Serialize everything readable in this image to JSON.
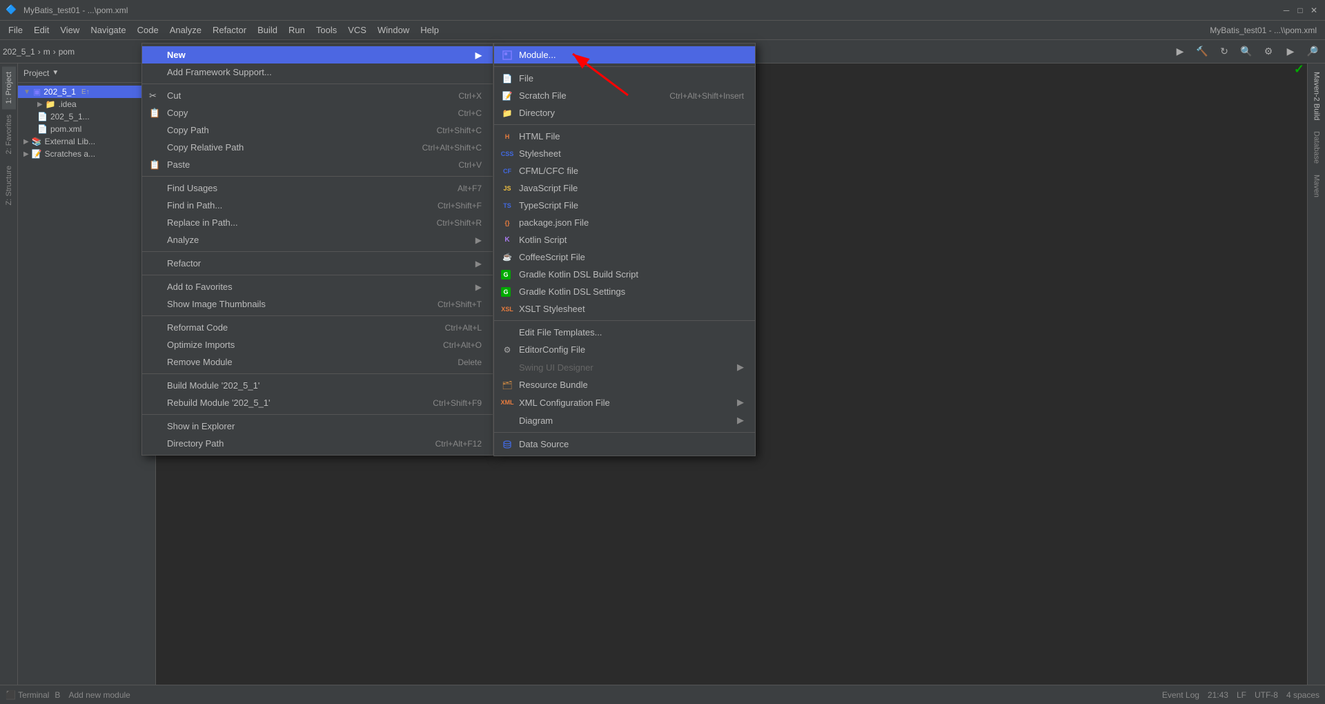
{
  "app": {
    "title": "MyBatis_test01 - ...\\pom.xml",
    "logo": "🔷"
  },
  "titleBar": {
    "title": "MyBatis_test01 - ...\\pom.xml",
    "minimizeLabel": "─",
    "maximizeLabel": "□",
    "closeLabel": "✕"
  },
  "menuBar": {
    "items": [
      "File",
      "Edit",
      "View",
      "Navigate",
      "Code",
      "Analyze",
      "Refactor",
      "Build",
      "Run",
      "Tools",
      "VCS",
      "Window",
      "Help"
    ]
  },
  "toolbar": {
    "breadcrumb": [
      "202_5_1",
      "m",
      "pom"
    ]
  },
  "projectPanel": {
    "title": "Project",
    "items": [
      {
        "label": "202_5_1",
        "indent": 0,
        "type": "module",
        "selected": true
      },
      {
        "label": ".idea",
        "indent": 1,
        "type": "folder"
      },
      {
        "label": "202_5_1...",
        "indent": 1,
        "type": "file"
      },
      {
        "label": "pom.xml",
        "indent": 1,
        "type": "file"
      },
      {
        "label": "External Lib...",
        "indent": 0,
        "type": "lib"
      },
      {
        "label": "Scratches a...",
        "indent": 0,
        "type": "scratch"
      }
    ]
  },
  "contextMenu": {
    "items": [
      {
        "id": "new",
        "label": "New",
        "shortcut": "",
        "arrow": true,
        "icon": "",
        "highlighted": true
      },
      {
        "id": "add-framework",
        "label": "Add Framework Support...",
        "shortcut": ""
      },
      {
        "separator": true
      },
      {
        "id": "cut",
        "label": "Cut",
        "shortcut": "Ctrl+X",
        "icon": "✂"
      },
      {
        "id": "copy",
        "label": "Copy",
        "shortcut": "Ctrl+C",
        "icon": "📋"
      },
      {
        "id": "copy-path",
        "label": "Copy Path",
        "shortcut": "Ctrl+Shift+C"
      },
      {
        "id": "copy-relative",
        "label": "Copy Relative Path",
        "shortcut": "Ctrl+Alt+Shift+C"
      },
      {
        "id": "paste",
        "label": "Paste",
        "shortcut": "Ctrl+V",
        "icon": "📋"
      },
      {
        "separator": true
      },
      {
        "id": "find-usages",
        "label": "Find Usages",
        "shortcut": "Alt+F7"
      },
      {
        "id": "find-in-path",
        "label": "Find in Path...",
        "shortcut": "Ctrl+Shift+F"
      },
      {
        "id": "replace-in-path",
        "label": "Replace in Path...",
        "shortcut": "Ctrl+Shift+R"
      },
      {
        "id": "analyze",
        "label": "Analyze",
        "shortcut": "",
        "arrow": true
      },
      {
        "separator": true
      },
      {
        "id": "refactor",
        "label": "Refactor",
        "shortcut": "",
        "arrow": true
      },
      {
        "separator": true
      },
      {
        "id": "add-to-favorites",
        "label": "Add to Favorites",
        "shortcut": "",
        "arrow": true
      },
      {
        "id": "show-thumbnails",
        "label": "Show Image Thumbnails",
        "shortcut": "Ctrl+Shift+T"
      },
      {
        "separator": true
      },
      {
        "id": "reformat",
        "label": "Reformat Code",
        "shortcut": "Ctrl+Alt+L"
      },
      {
        "id": "optimize-imports",
        "label": "Optimize Imports",
        "shortcut": "Ctrl+Alt+O"
      },
      {
        "id": "remove-module",
        "label": "Remove Module",
        "shortcut": "Delete"
      },
      {
        "separator": true
      },
      {
        "id": "build-module",
        "label": "Build Module '202_5_1'",
        "shortcut": ""
      },
      {
        "id": "rebuild-module",
        "label": "Rebuild Module '202_5_1'",
        "shortcut": "Ctrl+Shift+F9"
      },
      {
        "separator": true
      },
      {
        "id": "show-explorer",
        "label": "Show in Explorer",
        "shortcut": ""
      },
      {
        "id": "directory-path",
        "label": "Directory Path",
        "shortcut": "Ctrl+Alt+F12"
      }
    ]
  },
  "submenu": {
    "items": [
      {
        "id": "module",
        "label": "Module...",
        "shortcut": "",
        "icon": "module",
        "highlighted": true
      },
      {
        "separator": true
      },
      {
        "id": "file",
        "label": "File",
        "shortcut": "",
        "icon": "file"
      },
      {
        "id": "scratch",
        "label": "Scratch File",
        "shortcut": "Ctrl+Alt+Shift+Insert",
        "icon": "scratch"
      },
      {
        "id": "directory",
        "label": "Directory",
        "shortcut": "",
        "icon": "dir"
      },
      {
        "separator": true
      },
      {
        "id": "html",
        "label": "HTML File",
        "shortcut": "",
        "icon": "html"
      },
      {
        "id": "stylesheet",
        "label": "Stylesheet",
        "shortcut": "",
        "icon": "css"
      },
      {
        "id": "cfml",
        "label": "CFML/CFC file",
        "shortcut": "",
        "icon": "cfml"
      },
      {
        "id": "javascript",
        "label": "JavaScript File",
        "shortcut": "",
        "icon": "js"
      },
      {
        "id": "typescript",
        "label": "TypeScript File",
        "shortcut": "",
        "icon": "ts"
      },
      {
        "id": "package-json",
        "label": "package.json File",
        "shortcut": "",
        "icon": "json"
      },
      {
        "id": "kotlin-script",
        "label": "Kotlin Script",
        "shortcut": "",
        "icon": "kotlin"
      },
      {
        "id": "coffeescript",
        "label": "CoffeeScript File",
        "shortcut": "",
        "icon": "coffee"
      },
      {
        "id": "gradle-dsl",
        "label": "Gradle Kotlin DSL Build Script",
        "shortcut": "",
        "icon": "gradle-g"
      },
      {
        "id": "gradle-settings",
        "label": "Gradle Kotlin DSL Settings",
        "shortcut": "",
        "icon": "gradle-g"
      },
      {
        "id": "xslt",
        "label": "XSLT Stylesheet",
        "shortcut": "",
        "icon": "xslt"
      },
      {
        "separator": true
      },
      {
        "id": "edit-templates",
        "label": "Edit File Templates...",
        "shortcut": ""
      },
      {
        "id": "editorconfig",
        "label": "EditorConfig File",
        "shortcut": "",
        "icon": "gear"
      },
      {
        "id": "swing-ui",
        "label": "Swing UI Designer",
        "shortcut": "",
        "arrow": true,
        "disabled": true
      },
      {
        "id": "resource-bundle",
        "label": "Resource Bundle",
        "shortcut": "",
        "icon": "bundle"
      },
      {
        "id": "xml-config",
        "label": "XML Configuration File",
        "shortcut": "",
        "icon": "xml",
        "arrow": true
      },
      {
        "id": "diagram",
        "label": "Diagram",
        "shortcut": "",
        "arrow": true
      },
      {
        "separator": true
      },
      {
        "id": "data-source",
        "label": "Data Source",
        "shortcut": "",
        "icon": "db"
      }
    ]
  },
  "statusBar": {
    "left": {
      "terminal": "Terminal",
      "build": "B"
    },
    "addModule": "Add new module",
    "right": {
      "position": "21:43",
      "lineEnding": "LF",
      "encoding": "UTF-8",
      "indent": "4 spaces",
      "eventLog": "Event Log"
    }
  },
  "rightTabs": [
    "Maven-2 Build",
    "Database",
    "Maven"
  ],
  "leftTabs": [
    "1: Project",
    "2: Favorites",
    "Z: Structure"
  ]
}
